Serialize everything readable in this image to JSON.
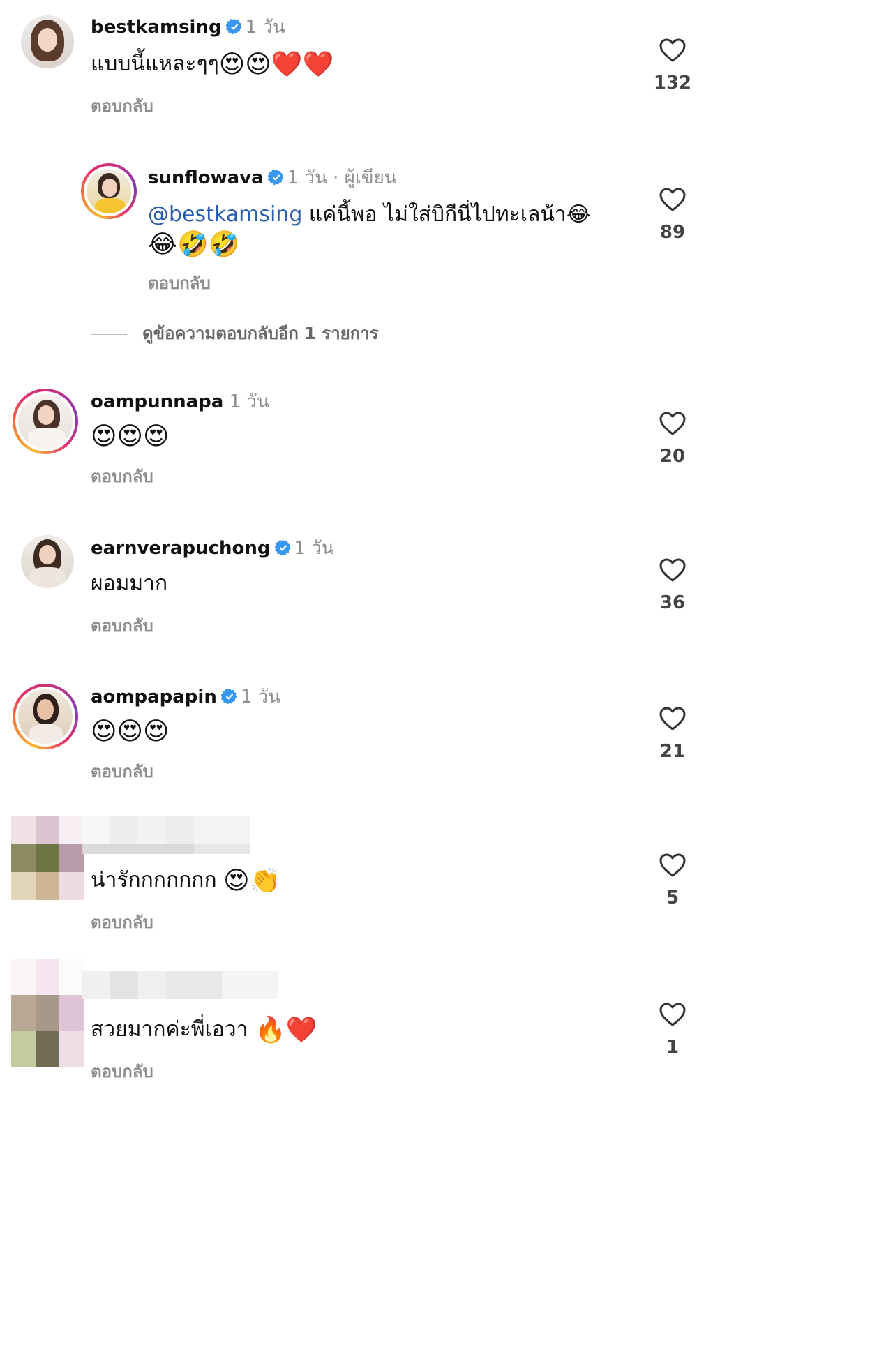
{
  "comments": [
    {
      "username": "bestkamsing",
      "verified": true,
      "time": "1 วัน",
      "text": "แบบนี้แหละๆๆ",
      "emojis": "😍😍❤️❤️",
      "reply_label": "ตอบกลับ",
      "likes": "132"
    },
    {
      "username": "sunflowava",
      "verified": true,
      "time": "1 วัน",
      "author_tag": "· ผู้เขียน",
      "mention": "@bestkamsing",
      "text": " แค่นี้พอ ไม่ใส่บิกีนี่ไปทะเลน้า😂",
      "text_line2": "😂🤣🤣",
      "reply_label": "ตอบกลับ",
      "likes": "89"
    },
    {
      "username": "oampunnapa",
      "verified": false,
      "time": "1 วัน",
      "emojis": "😍😍😍",
      "reply_label": "ตอบกลับ",
      "likes": "20"
    },
    {
      "username": "earnverapuchong",
      "verified": true,
      "time": "1 วัน",
      "text": "ผอมมาก",
      "reply_label": "ตอบกลับ",
      "likes": "36"
    },
    {
      "username": "aompapapin",
      "verified": true,
      "time": "1 วัน",
      "emojis": "😍😍😍",
      "reply_label": "ตอบกลับ",
      "likes": "21"
    },
    {
      "text": "น่ารักกกกกกก ",
      "emojis": "😍👏",
      "reply_label": "ตอบกลับ",
      "likes": "5"
    },
    {
      "text": "สวยมากค่ะพี่เอวา ",
      "emojis": "🔥❤️",
      "reply_label": "ตอบกลับ",
      "likes": "1"
    }
  ],
  "view_more_replies": "ดูข้อความตอบกลับอีก 1 รายการ",
  "colors": {
    "verified_badge": "#3897f0",
    "mention": "#2a5db0",
    "muted_text": "#8e8e8e"
  },
  "icons": {
    "like": "heart-outline-icon",
    "verified": "verified-badge-icon"
  }
}
